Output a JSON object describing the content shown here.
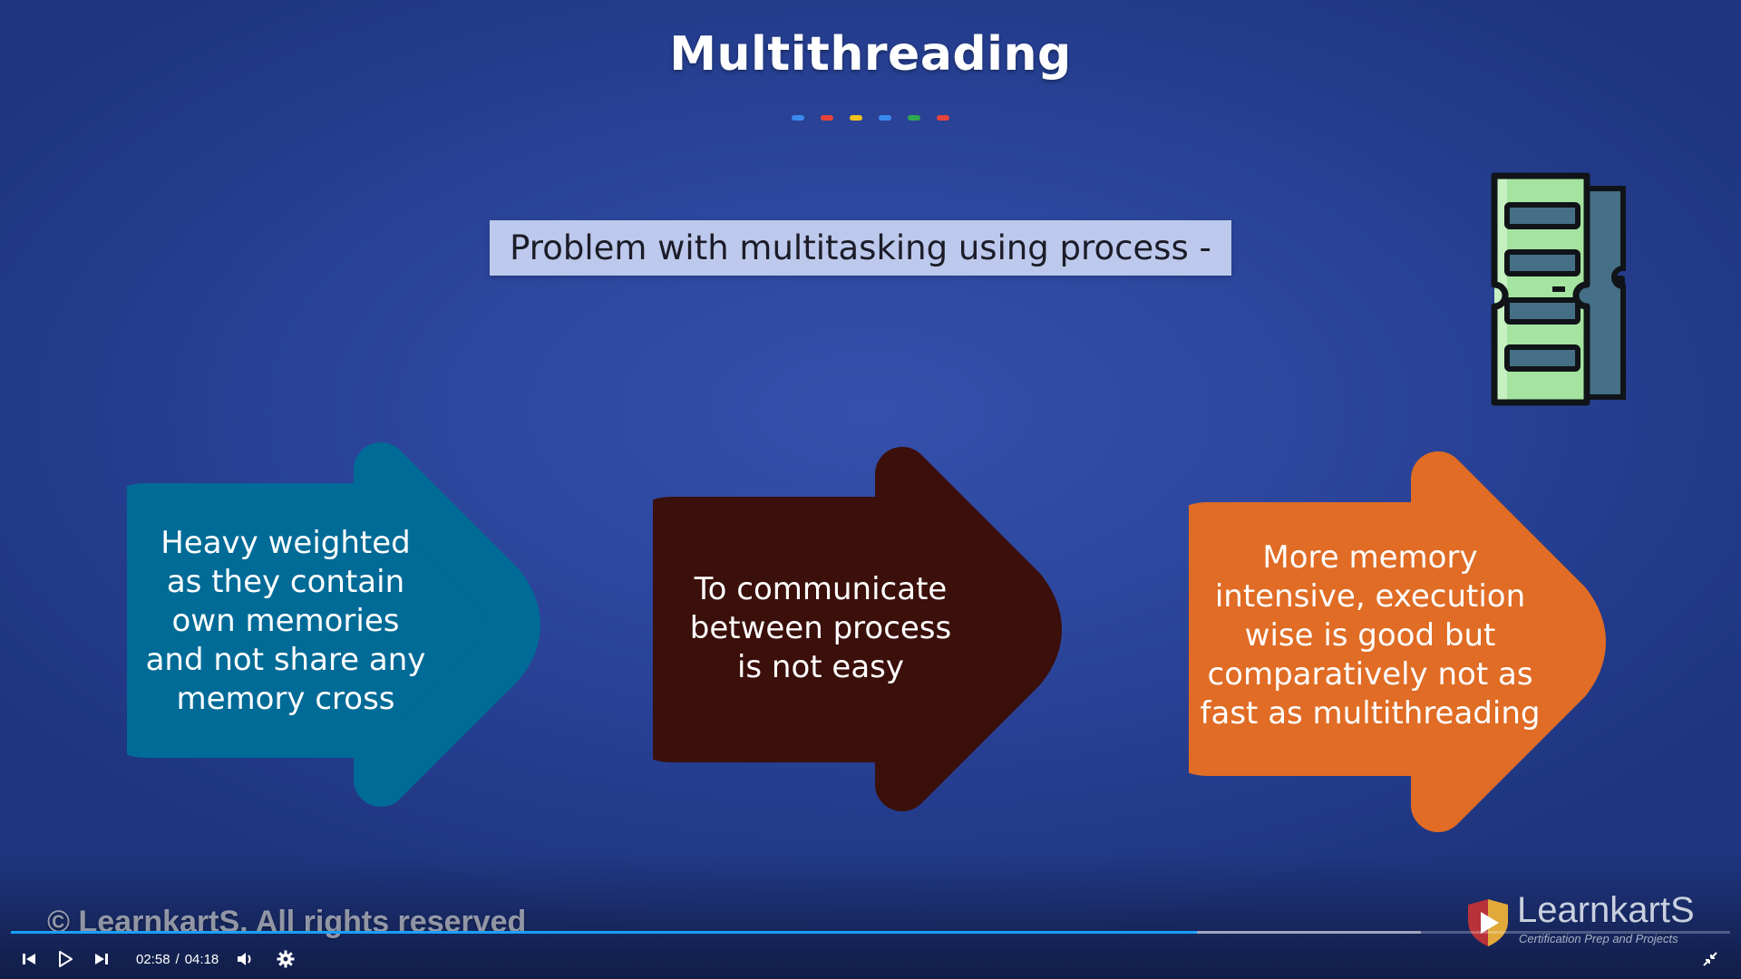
{
  "slide": {
    "title": "Multithreading",
    "dot_colors": [
      "#3b8af0",
      "#e8433a",
      "#f3c21a",
      "#3b8af0",
      "#2fa84f",
      "#e8433a"
    ],
    "banner": "Problem with multitasking using process -",
    "arrows": [
      {
        "text": "Heavy weighted as they contain own memories and not share any memory cross",
        "color": "#006b97"
      },
      {
        "text": "To communicate between process is not easy",
        "color": "#3b0f0a"
      },
      {
        "text": "More memory intensive, execution wise is good but comparatively not as fast as multithreading",
        "color": "#e06c25"
      }
    ],
    "icon": "ram-memory-icon",
    "copyright": "© LearnkartS. All rights reserved"
  },
  "logo": {
    "name": "LearnkartS",
    "tagline": "Certification Prep and Projects"
  },
  "player": {
    "current_time": "02:58",
    "separator": "/",
    "duration": "04:18",
    "progress_fraction": 0.69,
    "buffered_fraction": 0.82,
    "accent_color": "#1a9fff",
    "icons": [
      "skip-back-icon",
      "play-icon",
      "skip-forward-icon",
      "volume-icon",
      "settings-gear-icon",
      "exit-fullscreen-icon"
    ]
  }
}
